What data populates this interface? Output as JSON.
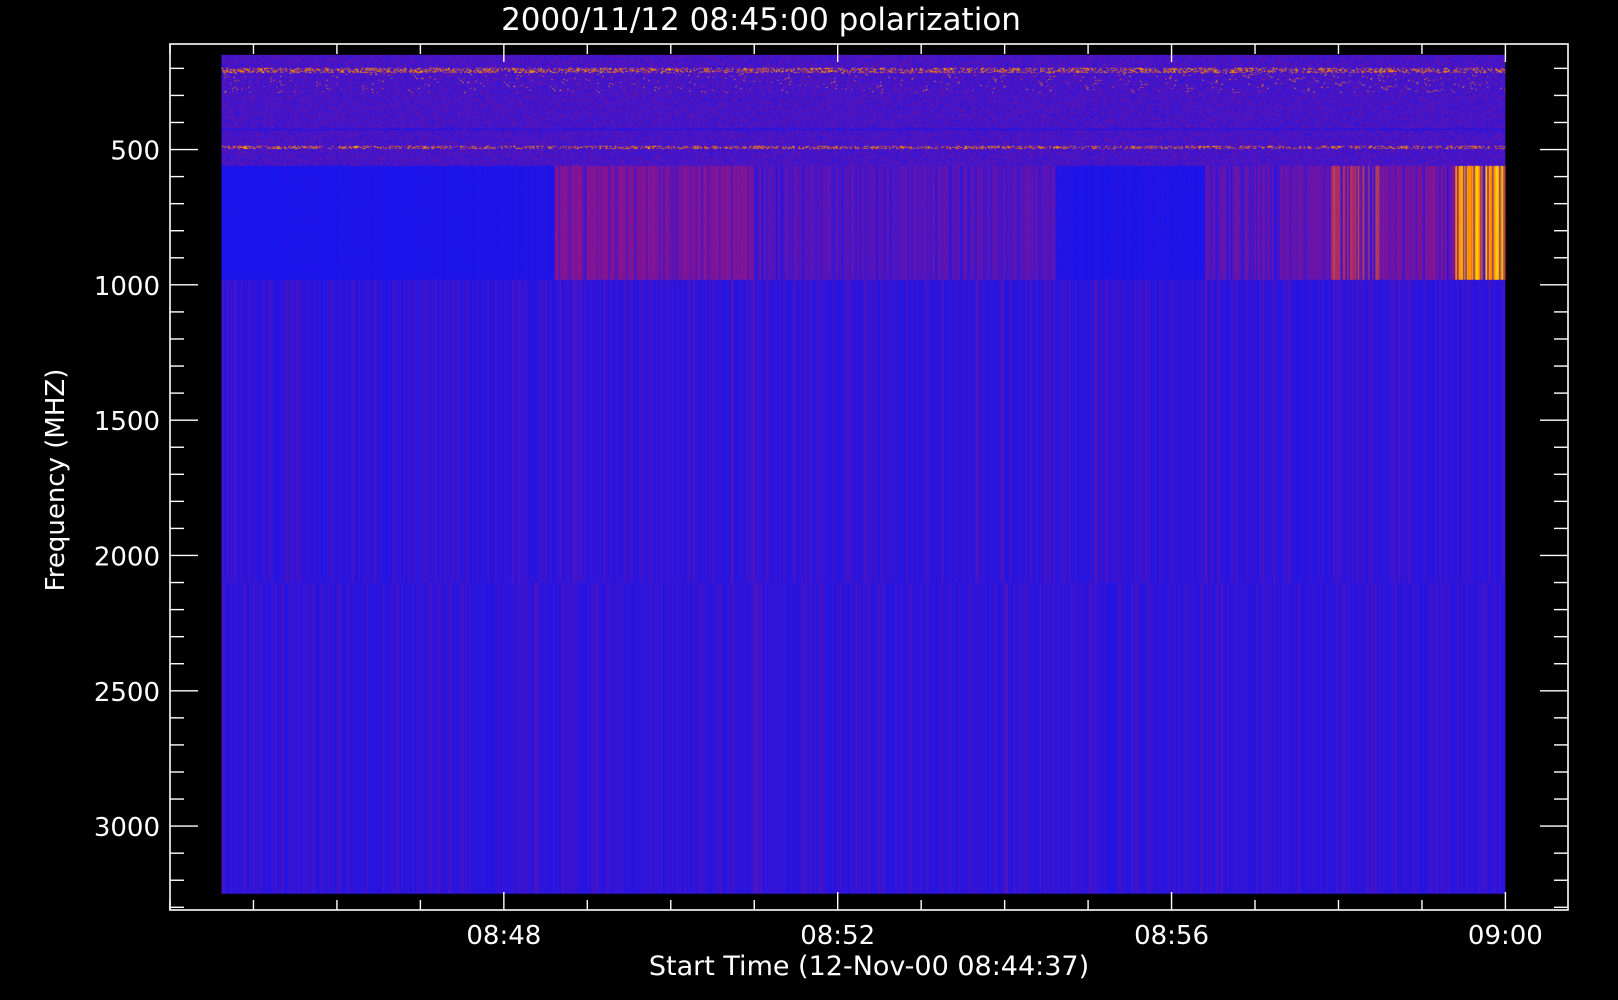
{
  "chart_data": {
    "type": "heatmap",
    "title": "2000/11/12 08:45:00 polarization",
    "xlabel": "Start Time (12-Nov-00 08:44:37)",
    "ylabel": "Frequency (MHZ)",
    "x_time_range": [
      "08:44:37",
      "09:00:00"
    ],
    "x_axis_range": [
      "08:44:00",
      "09:00:45"
    ],
    "x_major_ticks": [
      "08:48",
      "08:52",
      "08:56",
      "09:00"
    ],
    "x_minor_tick_interval_min": 1,
    "y_range": [
      3250,
      150
    ],
    "y_axis_range": [
      3310,
      110
    ],
    "y_inverted": true,
    "y_major_ticks": [
      500,
      1000,
      1500,
      2000,
      2500,
      3000
    ],
    "y_minor_tick_interval": 100,
    "colors": {
      "background": "#000000",
      "axis": "#ffffff",
      "low": "#1414f0",
      "mid": "#8c148c",
      "high": "#ff7800",
      "peak": "#ffd700"
    },
    "bands": [
      {
        "freq_range": [
          150,
          560
        ],
        "appearance": "noisy, blue with scattered red/orange interference lines near 200-290 and at 490 MHz"
      },
      {
        "freq_range": [
          560,
          980
        ],
        "appearance": "blue, red striations around 08:49-08:50, 08:56-08:58, strongest orange/yellow at 08:59-09:00"
      },
      {
        "freq_range": [
          980,
          2100
        ],
        "appearance": "blue with fine red vertical striations"
      },
      {
        "freq_range": [
          2100,
          3250
        ],
        "appearance": "blue with fine red vertical striations"
      }
    ]
  }
}
